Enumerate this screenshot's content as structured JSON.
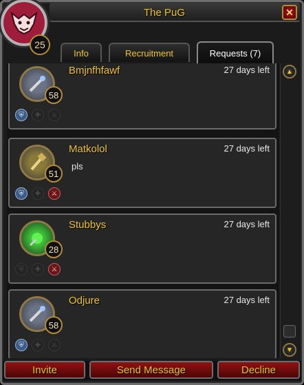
{
  "window": {
    "title": "The PuG",
    "guild_level": "25",
    "close_icon": "close-x-icon",
    "emblem_icon": "beast-emblem-icon",
    "accent_color": "#f0c624",
    "button_color": "#8e1212"
  },
  "tabs": [
    {
      "label": "Info"
    },
    {
      "label": "Recruitment"
    },
    {
      "label": "Requests (7)"
    }
  ],
  "requests": [
    {
      "name": "Bmjnfhfawf",
      "level": "58",
      "time_left": "27 days left",
      "message": "",
      "class_icon": "mage-staff-icon",
      "roles": {
        "tank": true,
        "heal": false,
        "dps": false
      }
    },
    {
      "name": "Matkolol",
      "level": "51",
      "time_left": "27 days left",
      "message": "pls",
      "class_icon": "paladin-hammer-icon",
      "roles": {
        "tank": true,
        "heal": false,
        "dps": true
      }
    },
    {
      "name": "Stubbys",
      "level": "28",
      "time_left": "27 days left",
      "message": "",
      "class_icon": "fel-orb-icon",
      "roles": {
        "tank": false,
        "heal": false,
        "dps": true
      }
    },
    {
      "name": "Odjure",
      "level": "58",
      "time_left": "27 days left",
      "message": "",
      "class_icon": "mage-staff-icon",
      "roles": {
        "tank": true,
        "heal": false,
        "dps": false
      }
    }
  ],
  "footer": {
    "invite": "Invite",
    "send_message": "Send Message",
    "decline": "Decline"
  }
}
